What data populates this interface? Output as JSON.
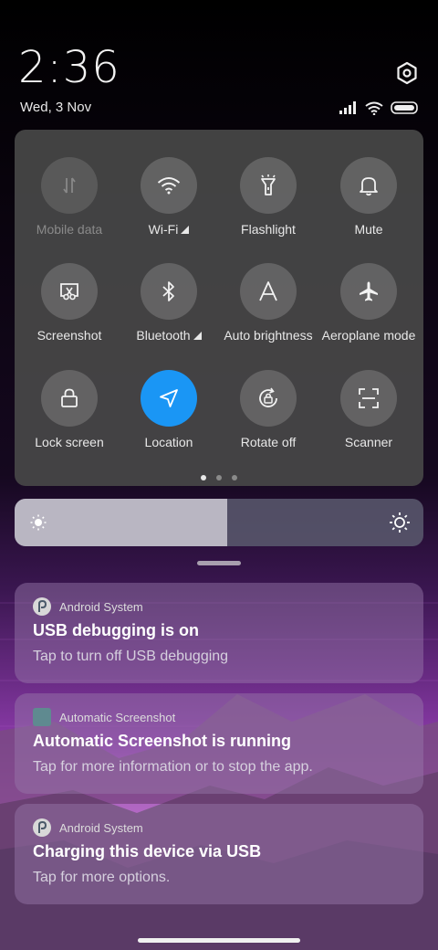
{
  "status": {
    "time": "2:36",
    "date": "Wed, 3 Nov"
  },
  "tiles": [
    {
      "label": "Mobile data",
      "icon": "mobile-data-icon",
      "active": false,
      "disabled": true
    },
    {
      "label": "Wi-Fi",
      "icon": "wifi-icon",
      "active": false,
      "disabled": false
    },
    {
      "label": "Flashlight",
      "icon": "flashlight-icon",
      "active": false,
      "disabled": false
    },
    {
      "label": "Mute",
      "icon": "bell-icon",
      "active": false,
      "disabled": false
    },
    {
      "label": "Screenshot",
      "icon": "screenshot-icon",
      "active": false,
      "disabled": false
    },
    {
      "label": "Bluetooth",
      "icon": "bluetooth-icon",
      "active": false,
      "disabled": false
    },
    {
      "label": "Auto brightness",
      "icon": "auto-brightness-icon",
      "active": false,
      "disabled": false
    },
    {
      "label": "Aeroplane mode",
      "icon": "airplane-icon",
      "active": false,
      "disabled": false
    },
    {
      "label": "Lock screen",
      "icon": "lock-icon",
      "active": false,
      "disabled": false
    },
    {
      "label": "Location",
      "icon": "location-icon",
      "active": true,
      "disabled": false
    },
    {
      "label": "Rotate off",
      "icon": "rotate-lock-icon",
      "active": false,
      "disabled": false
    },
    {
      "label": "Scanner",
      "icon": "scanner-icon",
      "active": false,
      "disabled": false
    }
  ],
  "page_indicator": {
    "pages": 3,
    "current": 1
  },
  "brightness": {
    "level": 0.52
  },
  "notifications": [
    {
      "app": "Android System",
      "title": "USB debugging is on",
      "body": "Tap to turn off USB debugging"
    },
    {
      "app": "Automatic Screenshot",
      "title": "Automatic Screenshot is running",
      "body": "Tap for more information or to stop the app."
    },
    {
      "app": "Android System",
      "title": "Charging this device via USB",
      "body": "Tap for more options."
    }
  ],
  "colors": {
    "accent": "#1a96f5",
    "panel": "#484848",
    "tile": "#6e6e6e"
  }
}
